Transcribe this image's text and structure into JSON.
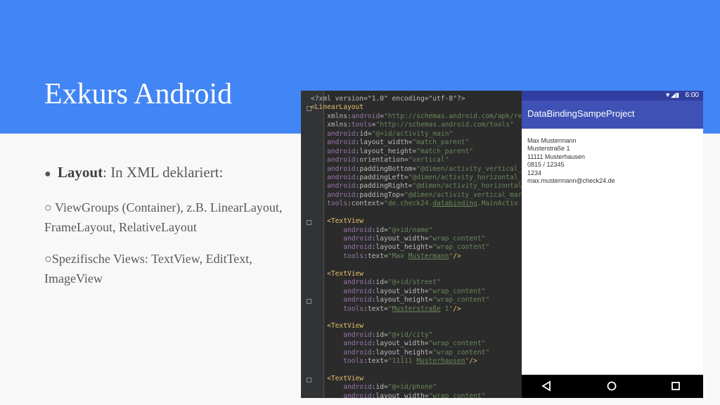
{
  "slide": {
    "title": "Exkurs Android",
    "bullet_main": {
      "symbol": "●",
      "term": "Layout",
      "rest": ": In XML deklariert:"
    },
    "sub_items": [
      "○ ViewGroups (Container), z.B. LinearLayout, FrameLayout, RelativeLayout",
      "○Spezifische Views: TextView, EditText, ImageView"
    ]
  },
  "code_lines": [
    [
      [
        "<?xml version=\"1.0\" encoding=\"utf-8\"?>",
        "a"
      ]
    ],
    [
      [
        "<LinearLayout",
        "t"
      ]
    ],
    [
      [
        "    xmlns:",
        "a"
      ],
      [
        "android",
        "ns"
      ],
      [
        "=",
        "a"
      ],
      [
        "\"http://schemas.android.com/apk/res",
        "s"
      ]
    ],
    [
      [
        "    xmlns:",
        "a"
      ],
      [
        "tools",
        "ns"
      ],
      [
        "=",
        "a"
      ],
      [
        "\"http://schemas.android.com/tools\"",
        "s"
      ]
    ],
    [
      [
        "    android",
        "ns"
      ],
      [
        ":id=",
        "a"
      ],
      [
        "\"@+id/activity_main\"",
        "s"
      ]
    ],
    [
      [
        "    android",
        "ns"
      ],
      [
        ":layout_width=",
        "a"
      ],
      [
        "\"match_parent\"",
        "s"
      ]
    ],
    [
      [
        "    android",
        "ns"
      ],
      [
        ":layout_height=",
        "a"
      ],
      [
        "\"match_parent\"",
        "s"
      ]
    ],
    [
      [
        "    android",
        "ns"
      ],
      [
        ":orientation=",
        "a"
      ],
      [
        "\"vertical\"",
        "s"
      ]
    ],
    [
      [
        "    android",
        "ns"
      ],
      [
        ":paddingBottom=",
        "a"
      ],
      [
        "\"@dimen/activity_vertical_",
        "s"
      ]
    ],
    [
      [
        "    android",
        "ns"
      ],
      [
        ":paddingLeft=",
        "a"
      ],
      [
        "\"@dimen/activity_horizontal_",
        "s"
      ]
    ],
    [
      [
        "    android",
        "ns"
      ],
      [
        ":paddingRight=",
        "a"
      ],
      [
        "\"@dimen/activity_horizontal",
        "s"
      ]
    ],
    [
      [
        "    android",
        "ns"
      ],
      [
        ":paddingTop=",
        "a"
      ],
      [
        "\"@dimen/activity_vertical_mar",
        "s"
      ]
    ],
    [
      [
        "    tools",
        "ns"
      ],
      [
        ":context=",
        "a"
      ],
      [
        "\"de.check24.",
        "s"
      ],
      [
        "databinding",
        "s u"
      ],
      [
        ".MainActiv",
        "s"
      ]
    ],
    [
      [
        "",
        "a"
      ]
    ],
    [
      [
        "    <TextView",
        "t"
      ]
    ],
    [
      [
        "        android",
        "ns"
      ],
      [
        ":id=",
        "a"
      ],
      [
        "\"@+id/name\"",
        "s"
      ]
    ],
    [
      [
        "        android",
        "ns"
      ],
      [
        ":layout_width=",
        "a"
      ],
      [
        "\"wrap_content\"",
        "s"
      ]
    ],
    [
      [
        "        android",
        "ns"
      ],
      [
        ":layout_height=",
        "a"
      ],
      [
        "\"wrap_content\"",
        "s"
      ]
    ],
    [
      [
        "        tools",
        "ns"
      ],
      [
        ":text=",
        "a"
      ],
      [
        "\"Max ",
        "s"
      ],
      [
        "Mustermann",
        "s u"
      ],
      [
        "\"",
        "s"
      ],
      [
        "/>",
        "t"
      ]
    ],
    [
      [
        "",
        "a"
      ]
    ],
    [
      [
        "    <TextView",
        "t"
      ]
    ],
    [
      [
        "        android",
        "ns"
      ],
      [
        ":id=",
        "a"
      ],
      [
        "\"@+id/street\"",
        "s"
      ]
    ],
    [
      [
        "        android",
        "ns"
      ],
      [
        ":layout_width=",
        "a"
      ],
      [
        "\"wrap_content\"",
        "s"
      ]
    ],
    [
      [
        "        android",
        "ns"
      ],
      [
        ":layout_height=",
        "a"
      ],
      [
        "\"wrap_content\"",
        "s"
      ]
    ],
    [
      [
        "        tools",
        "ns"
      ],
      [
        ":text=",
        "a"
      ],
      [
        "\"",
        "s"
      ],
      [
        "Musterstraße",
        "s u"
      ],
      [
        " 1\"",
        "s"
      ],
      [
        "/>",
        "t"
      ]
    ],
    [
      [
        "",
        "a"
      ]
    ],
    [
      [
        "    <TextView",
        "t"
      ]
    ],
    [
      [
        "        android",
        "ns"
      ],
      [
        ":id=",
        "a"
      ],
      [
        "\"@+id/city\"",
        "s"
      ]
    ],
    [
      [
        "        android",
        "ns"
      ],
      [
        ":layout_width=",
        "a"
      ],
      [
        "\"wrap_content\"",
        "s"
      ]
    ],
    [
      [
        "        android",
        "ns"
      ],
      [
        ":layout_height=",
        "a"
      ],
      [
        "\"wrap_content\"",
        "s"
      ]
    ],
    [
      [
        "        tools",
        "ns"
      ],
      [
        ":text=",
        "a"
      ],
      [
        "\"11111 ",
        "s"
      ],
      [
        "Musterhausen",
        "s u"
      ],
      [
        "\"",
        "s"
      ],
      [
        "/>",
        "t"
      ]
    ],
    [
      [
        "",
        "a"
      ]
    ],
    [
      [
        "    <TextView",
        "t"
      ]
    ],
    [
      [
        "        android",
        "ns"
      ],
      [
        ":id=",
        "a"
      ],
      [
        "\"@+id/phone\"",
        "s"
      ]
    ],
    [
      [
        "        android",
        "ns"
      ],
      [
        ":layout_width=",
        "a"
      ],
      [
        "\"wrap_content\"",
        "s"
      ]
    ]
  ],
  "phone": {
    "status_time": "6:00",
    "status_icons": "▼◢▮",
    "app_title": "DataBindingSampeProject",
    "lines": [
      "Max Mustermann",
      "Musterstraße 1",
      "11111 Musterhausen",
      "0815 / 12345",
      "1234",
      "max.mustermann@check24.de"
    ],
    "nav_icons": [
      "back-icon",
      "home-icon",
      "recents-icon"
    ]
  },
  "colors": {
    "banner": "#4285f4",
    "status_bar": "#303f9f",
    "app_bar": "#3f51b5",
    "editor_bg": "#2b2b2b"
  }
}
